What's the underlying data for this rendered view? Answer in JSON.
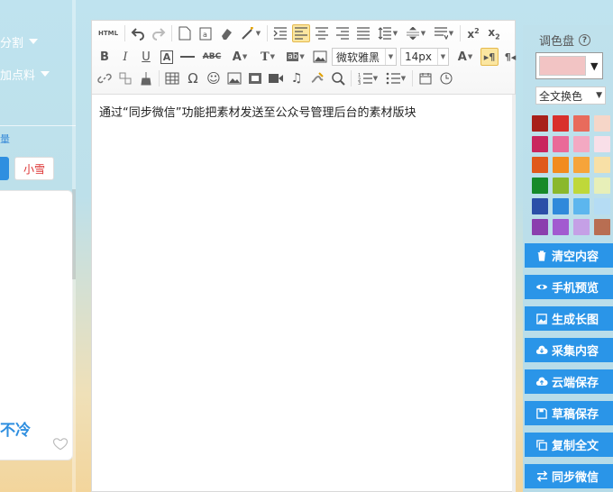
{
  "left": {
    "menu_item_1": "分割",
    "menu_item_2": "加点料",
    "link_text": "量",
    "tag_button": "小雪",
    "card_title": "不冷"
  },
  "toolbar": {
    "html_label": "HTML",
    "font_family": "微软雅黑",
    "font_size": "14px"
  },
  "editor": {
    "content": "通过“同步微信”功能把素材发送至公众号管理后台的素材版块"
  },
  "palette": {
    "title": "调色盘",
    "current_color": "#f2c4c4",
    "mode_select": "全文换色",
    "swatches": [
      "#a8201a",
      "#d9302c",
      "#e86b5c",
      "#f6d6c8",
      "#c9265e",
      "#ea6a98",
      "#f3a9c2",
      "#f9dfe8",
      "#e0591b",
      "#f28b1e",
      "#f6a43a",
      "#f8e0a6",
      "#168a2a",
      "#8ab82c",
      "#bfd83a",
      "#e7efb8",
      "#2b4fa8",
      "#2f89db",
      "#5cb6ee",
      "#b5dcf4",
      "#8b3fae",
      "#a25ad0",
      "#c5a0e6",
      "#b86e52"
    ]
  },
  "actions": [
    {
      "label": "清空内容",
      "icon": "trash-icon"
    },
    {
      "label": "手机预览",
      "icon": "eye-icon"
    },
    {
      "label": "生成长图",
      "icon": "image-icon"
    },
    {
      "label": "采集内容",
      "icon": "cloud-download-icon"
    },
    {
      "label": "云端保存",
      "icon": "cloud-upload-icon"
    },
    {
      "label": "草稿保存",
      "icon": "save-icon"
    },
    {
      "label": "复制全文",
      "icon": "copy-icon"
    },
    {
      "label": "同步微信",
      "icon": "sync-icon"
    }
  ]
}
